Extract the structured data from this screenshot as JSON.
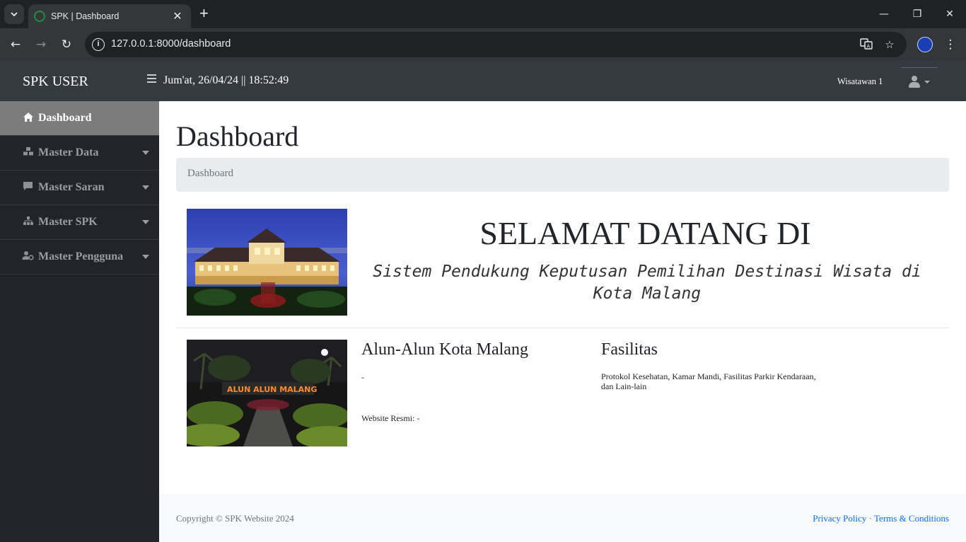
{
  "browser": {
    "tab_title": "SPK | Dashboard",
    "url": "127.0.0.1:8000/dashboard"
  },
  "topbar": {
    "brand": "SPK USER",
    "datetime": "Jum'at, 26/04/24 || 18:52:49",
    "user_name": "Wisatawan 1"
  },
  "sidebar": {
    "items": [
      {
        "label": "Dashboard",
        "icon": "home-icon",
        "active": true
      },
      {
        "label": "Master Data",
        "icon": "cubes-icon",
        "active": false
      },
      {
        "label": "Master Saran",
        "icon": "comment-icon",
        "active": false
      },
      {
        "label": "Master SPK",
        "icon": "sitemap-icon",
        "active": false
      },
      {
        "label": "Master Pengguna",
        "icon": "users-cog-icon",
        "active": false
      }
    ]
  },
  "main": {
    "title": "Dashboard",
    "breadcrumb": "Dashboard",
    "welcome_title": "SELAMAT DATANG DI",
    "welcome_subtitle": "Sistem Pendukung Keputusan Pemilihan Destinasi Wisata di Kota Malang",
    "destination": {
      "name": "Alun-Alun Kota Malang",
      "description": "-",
      "website": "Website Resmi: -",
      "sign_text": "ALUN ALUN MALANG"
    },
    "facilities": {
      "title": "Fasilitas",
      "text": "Protokol Kesehatan, Kamar Mandi, Fasilitas Parkir Kendaraan, dan Lain-lain"
    }
  },
  "footer": {
    "copyright": "Copyright © SPK Website 2024",
    "separator": "·",
    "privacy": "Privacy Policy",
    "terms": "Terms & Conditions"
  }
}
